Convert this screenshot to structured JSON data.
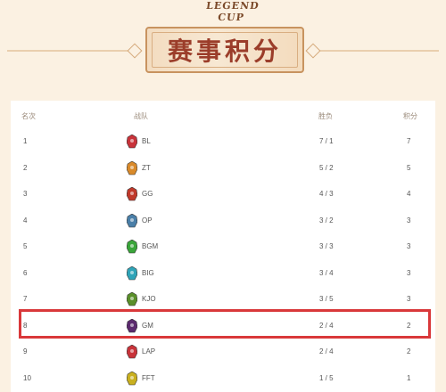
{
  "header": {
    "cup_text": "LEGEND CUP",
    "title": "赛事积分"
  },
  "table": {
    "columns": {
      "rank": "名次",
      "team": "战队",
      "record": "胜负",
      "points": "积分"
    },
    "rows": [
      {
        "rank": "1",
        "team": "BL",
        "record": "7 / 1",
        "points": "7",
        "logo_color": "#c8333a",
        "icon": "bl-team-logo-icon"
      },
      {
        "rank": "2",
        "team": "ZT",
        "record": "5 / 2",
        "points": "5",
        "logo_color": "#d98a2b",
        "icon": "zt-team-logo-icon"
      },
      {
        "rank": "3",
        "team": "GG",
        "record": "4 / 3",
        "points": "4",
        "logo_color": "#c0392b",
        "icon": "gg-team-logo-icon"
      },
      {
        "rank": "4",
        "team": "OP",
        "record": "3 / 2",
        "points": "3",
        "logo_color": "#4a7fa8",
        "icon": "op-team-logo-icon"
      },
      {
        "rank": "5",
        "team": "BGM",
        "record": "3 / 3",
        "points": "3",
        "logo_color": "#3aa53a",
        "icon": "bgm-team-logo-icon"
      },
      {
        "rank": "6",
        "team": "BIG",
        "record": "3 / 4",
        "points": "3",
        "logo_color": "#2fa4b8",
        "icon": "big-team-logo-icon"
      },
      {
        "rank": "7",
        "team": "KJO",
        "record": "3 / 5",
        "points": "3",
        "logo_color": "#5a8f2a",
        "icon": "kjo-team-logo-icon"
      },
      {
        "rank": "8",
        "team": "GM",
        "record": "2 / 4",
        "points": "2",
        "logo_color": "#5b2a6e",
        "icon": "gm-team-logo-icon"
      },
      {
        "rank": "9",
        "team": "LAP",
        "record": "2 / 4",
        "points": "2",
        "logo_color": "#c8333a",
        "icon": "lap-team-logo-icon"
      },
      {
        "rank": "10",
        "team": "FFT",
        "record": "1 / 5",
        "points": "1",
        "logo_color": "#c9b020",
        "icon": "fft-team-logo-icon"
      }
    ],
    "highlighted_rank": "8",
    "highlight_color": "#d9383a"
  },
  "colors": {
    "page_bg": "#fbf1e2",
    "title_red": "#9b3d2a",
    "banner_border": "#c8935f"
  }
}
